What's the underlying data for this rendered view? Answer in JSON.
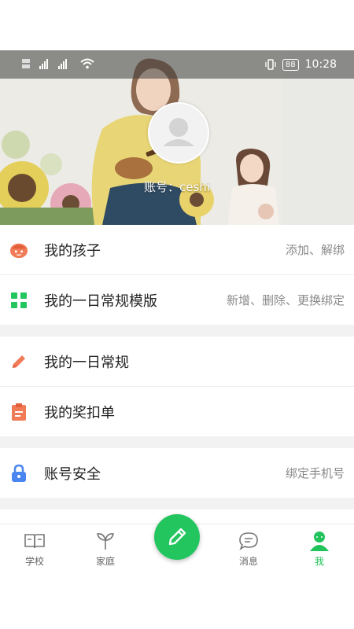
{
  "status_bar": {
    "time": "10:28",
    "battery": "88"
  },
  "profile": {
    "account_text": "账号：ceshi"
  },
  "menu": {
    "group1": [
      {
        "label": "我的孩子",
        "hint": "添加、解绑",
        "icon": "child-face-icon",
        "color": "#f07b56"
      },
      {
        "label": "我的一日常规模版",
        "hint": "新增、删除、更换绑定",
        "icon": "grid-icon",
        "color": "#22c55e"
      }
    ],
    "group2": [
      {
        "label": "我的一日常规",
        "icon": "pencil-icon",
        "color": "#f07b56"
      },
      {
        "label": "我的奖扣单",
        "icon": "clipboard-icon",
        "color": "#f07b56"
      }
    ],
    "group3": [
      {
        "label": "账号安全",
        "hint": "绑定手机号",
        "icon": "lock-icon",
        "color": "#4b86f0"
      }
    ]
  },
  "tabbar": {
    "items": [
      {
        "label": "学校",
        "icon": "book-icon"
      },
      {
        "label": "家庭",
        "icon": "sprout-icon"
      },
      {
        "label": "消息",
        "icon": "chat-icon"
      },
      {
        "label": "我",
        "icon": "person-icon",
        "active": true
      }
    ],
    "fab_icon": "pencil-icon",
    "accent": "#22c55e"
  }
}
